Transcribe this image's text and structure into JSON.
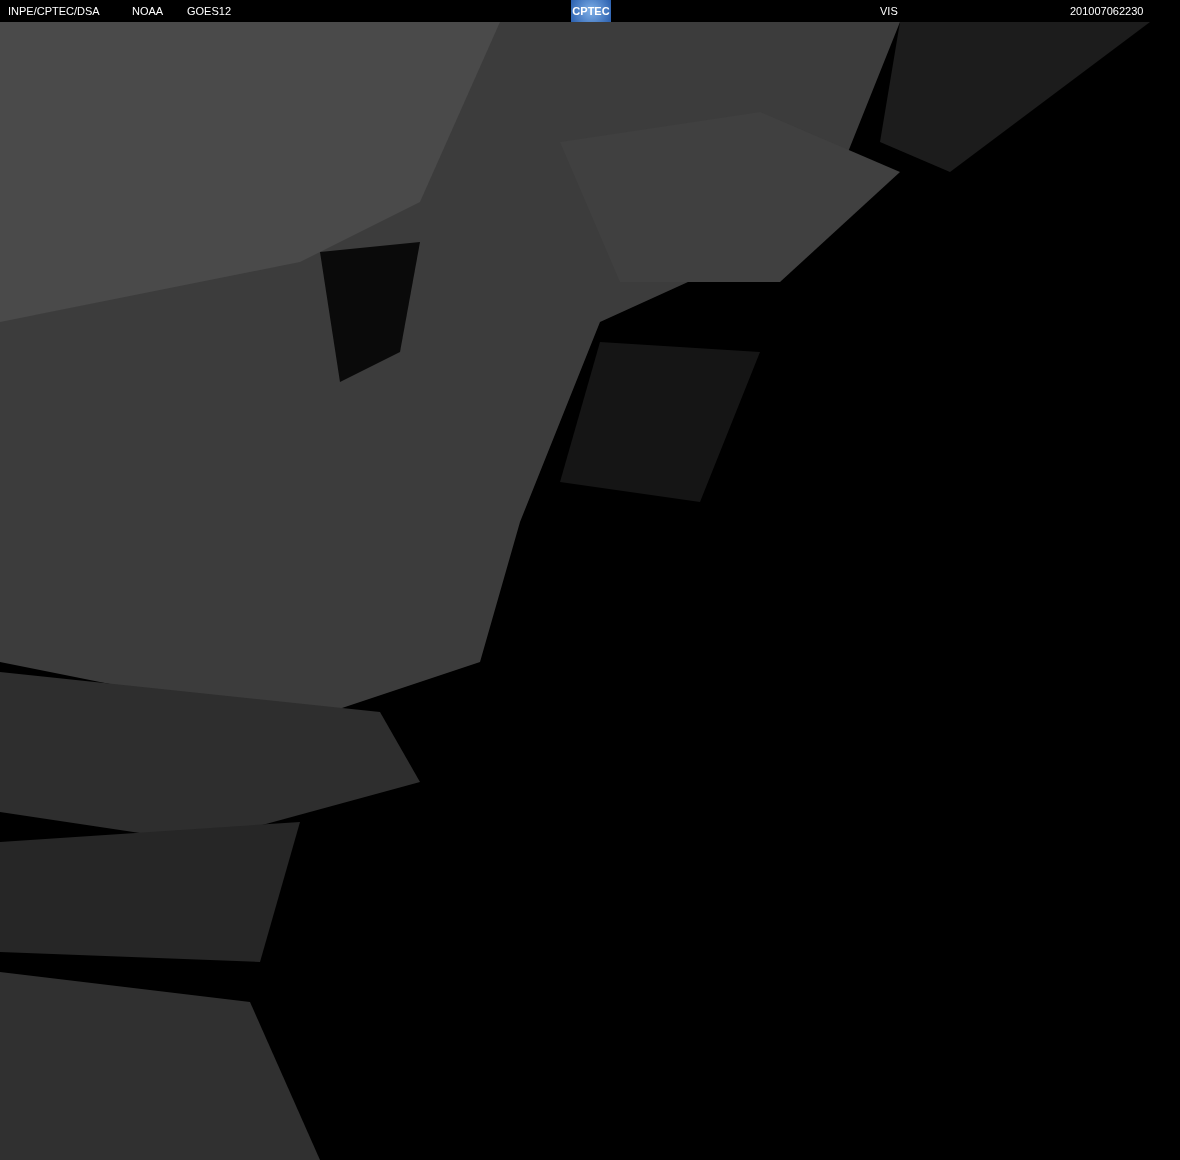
{
  "header": {
    "source": "INPE/CPTEC/DSA",
    "agency": "NOAA",
    "satellite": "GOES12",
    "logo": "CPTEC",
    "channel": "VIS",
    "timestamp": "201007062230"
  }
}
